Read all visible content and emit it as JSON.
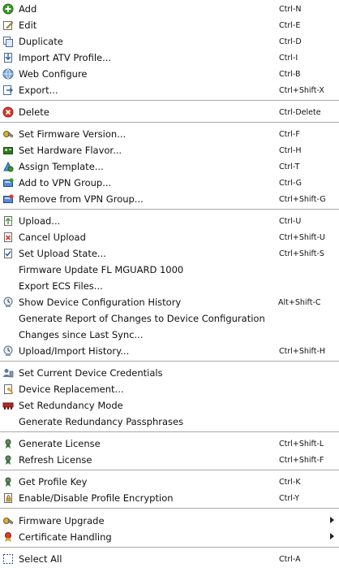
{
  "menu": {
    "items": [
      {
        "label": "Add",
        "shortcut": "Ctrl-N",
        "icon": "add-icon"
      },
      {
        "label": "Edit",
        "shortcut": "Ctrl-E",
        "icon": "edit-icon"
      },
      {
        "label": "Duplicate",
        "shortcut": "Ctrl-D",
        "icon": "duplicate-icon"
      },
      {
        "label": "Import ATV Profile...",
        "shortcut": "Ctrl-I",
        "icon": "import-icon"
      },
      {
        "label": "Web Configure",
        "shortcut": "Ctrl-B",
        "icon": "web-configure-icon"
      },
      {
        "label": "Export...",
        "shortcut": "Ctrl+Shift-X",
        "icon": "export-icon"
      },
      {
        "label": "Delete",
        "shortcut": "Ctrl-Delete",
        "icon": "delete-icon"
      },
      {
        "label": "Set Firmware Version...",
        "shortcut": "Ctrl-F",
        "icon": "firmware-version-icon"
      },
      {
        "label": "Set Hardware Flavor...",
        "shortcut": "Ctrl-H",
        "icon": "hardware-flavor-icon"
      },
      {
        "label": "Assign Template...",
        "shortcut": "Ctrl-T",
        "icon": "assign-template-icon"
      },
      {
        "label": "Add to VPN Group...",
        "shortcut": "Ctrl-G",
        "icon": "vpn-add-icon"
      },
      {
        "label": "Remove from VPN Group...",
        "shortcut": "Ctrl+Shift-G",
        "icon": "vpn-remove-icon"
      },
      {
        "label": "Upload...",
        "shortcut": "Ctrl-U",
        "icon": "upload-icon"
      },
      {
        "label": "Cancel Upload",
        "shortcut": "Ctrl+Shift-U",
        "icon": "cancel-upload-icon"
      },
      {
        "label": "Set Upload State...",
        "shortcut": "Ctrl+Shift-S",
        "icon": "upload-state-icon"
      },
      {
        "label": "Firmware Update FL MGUARD 1000",
        "shortcut": "",
        "icon": ""
      },
      {
        "label": "Export ECS Files...",
        "shortcut": "",
        "icon": ""
      },
      {
        "label": "Show Device Configuration History",
        "shortcut": "Alt+Shift-C",
        "icon": "history-icon"
      },
      {
        "label": "Generate Report of Changes to Device Configuration",
        "shortcut": "",
        "icon": ""
      },
      {
        "label": "Changes since Last Sync...",
        "shortcut": "",
        "icon": ""
      },
      {
        "label": "Upload/Import History...",
        "shortcut": "Ctrl+Shift-H",
        "icon": "history-icon"
      },
      {
        "label": "Set Current Device Credentials",
        "shortcut": "",
        "icon": "credentials-icon"
      },
      {
        "label": "Device Replacement...",
        "shortcut": "",
        "icon": "device-replacement-icon"
      },
      {
        "label": "Set Redundancy Mode",
        "shortcut": "",
        "icon": "redundancy-icon"
      },
      {
        "label": "Generate Redundancy Passphrases",
        "shortcut": "",
        "icon": ""
      },
      {
        "label": "Generate License",
        "shortcut": "Ctrl+Shift-L",
        "icon": "license-icon"
      },
      {
        "label": "Refresh License",
        "shortcut": "Ctrl+Shift-F",
        "icon": "license-icon"
      },
      {
        "label": "Get Profile Key",
        "shortcut": "Ctrl-K",
        "icon": "profile-key-icon"
      },
      {
        "label": "Enable/Disable Profile Encryption",
        "shortcut": "Ctrl-Y",
        "icon": "encryption-icon"
      },
      {
        "label": "Firmware Upgrade",
        "shortcut": "",
        "icon": "firmware-upgrade-icon"
      },
      {
        "label": "Certificate Handling",
        "shortcut": "",
        "icon": "certificate-icon"
      },
      {
        "label": "Select All",
        "shortcut": "Ctrl-A",
        "icon": "select-all-icon"
      }
    ]
  }
}
